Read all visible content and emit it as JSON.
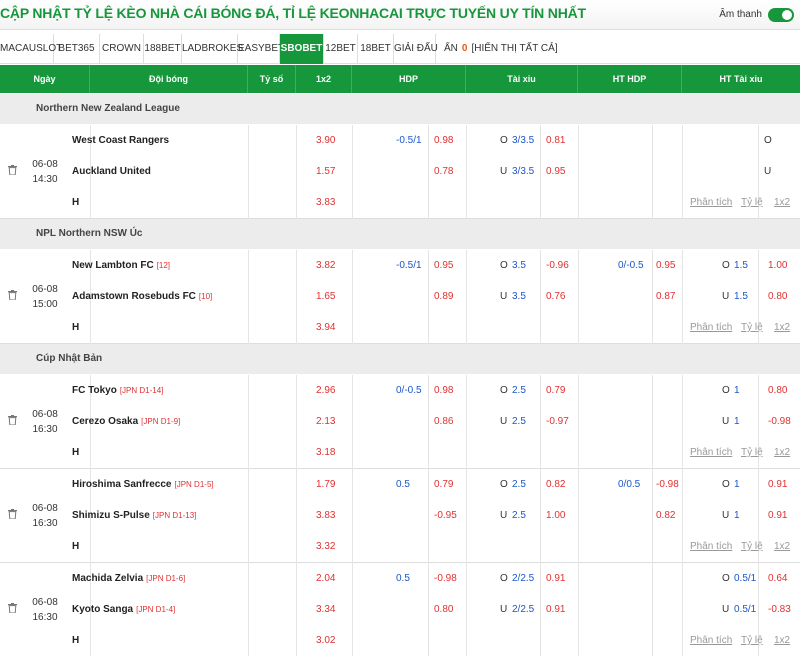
{
  "title": "CẬP NHẬT TỶ LỆ KÈO NHÀ CÁI BÓNG ĐÁ, TỈ LỆ KEONHACAI TRỰC TUYẾN UY TÍN NHẤT",
  "tabs": [
    {
      "label": "MACAUSLOT",
      "active": false
    },
    {
      "label": "BET365",
      "active": false
    },
    {
      "label": "CROWN",
      "active": false
    },
    {
      "label": "188BET",
      "active": false
    },
    {
      "label": "LADBROKES",
      "active": false
    },
    {
      "label": "EASYBET",
      "active": false
    },
    {
      "label": "SBOBET",
      "active": true
    },
    {
      "label": "12BET",
      "active": false
    },
    {
      "label": "18BET",
      "active": false
    },
    {
      "label": "GIẢI ĐẤU",
      "active": false
    }
  ],
  "hide": {
    "label_prefix": "ẨN",
    "count": "0",
    "show_all": "[HIỂN THỊ TẤT CẢ]"
  },
  "sound_label": "Âm thanh",
  "columns": {
    "date": "Ngày",
    "match": "Đội bóng",
    "score": "Tỷ số",
    "x12": "1x2",
    "hdp": "HDP",
    "ou": "Tài xỉu",
    "ht_hdp": "HT HDP",
    "ht_ou": "HT Tài xỉu"
  },
  "links": {
    "analysis": "Phân tích",
    "odds": "Tỷ lệ",
    "x12": "1x2"
  },
  "blocks": [
    {
      "type": "league",
      "name": "Northern New Zealand League"
    },
    {
      "type": "match",
      "date": "06-08",
      "time": "14:30",
      "height": 94,
      "home": {
        "name": "West Coast Rangers",
        "rank": "",
        "x12": "3.90",
        "hdp_line": "-0.5/1",
        "hdp_odd": "0.98",
        "ou_side": "O",
        "ou_line": "3/3.5",
        "ou_odd": "0.81",
        "hthdp_line": "",
        "hthdp_odd": "",
        "htou_side": "O",
        "htou_line": "",
        "htou_odd": ""
      },
      "away": {
        "name": "Auckland United",
        "rank": "",
        "x12": "1.57",
        "hdp_line": "",
        "hdp_odd": "0.78",
        "ou_side": "U",
        "ou_line": "3/3.5",
        "ou_odd": "0.95",
        "hthdp_line": "",
        "hthdp_odd": "",
        "htou_side": "U",
        "htou_line": "",
        "htou_odd": ""
      },
      "draw": {
        "label": "H",
        "x12": "3.83"
      }
    },
    {
      "type": "league",
      "name": "NPL Northern NSW Úc"
    },
    {
      "type": "match",
      "date": "06-08",
      "time": "15:00",
      "height": 94,
      "home": {
        "name": "New Lambton FC",
        "rank": "[12]",
        "x12": "3.82",
        "hdp_line": "-0.5/1",
        "hdp_odd": "0.95",
        "ou_side": "O",
        "ou_line": "3.5",
        "ou_odd": "-0.96",
        "hthdp_line": "0/-0.5",
        "hthdp_odd": "0.95",
        "htou_side": "O",
        "htou_line": "1.5",
        "htou_odd": "1.00"
      },
      "away": {
        "name": "Adamstown Rosebuds FC",
        "rank": "[10]",
        "x12": "1.65",
        "hdp_line": "",
        "hdp_odd": "0.89",
        "ou_side": "U",
        "ou_line": "3.5",
        "ou_odd": "0.76",
        "hthdp_line": "",
        "hthdp_odd": "0.87",
        "htou_side": "U",
        "htou_line": "1.5",
        "htou_odd": "0.80"
      },
      "draw": {
        "label": "H",
        "x12": "3.94"
      }
    },
    {
      "type": "league",
      "name": "Cúp Nhật Bản"
    },
    {
      "type": "match",
      "date": "06-08",
      "time": "16:30",
      "height": 94,
      "home": {
        "name": "FC Tokyo",
        "rank": "[JPN D1-14]",
        "x12": "2.96",
        "hdp_line": "0/-0.5",
        "hdp_odd": "0.98",
        "ou_side": "O",
        "ou_line": "2.5",
        "ou_odd": "0.79",
        "hthdp_line": "",
        "hthdp_odd": "",
        "htou_side": "O",
        "htou_line": "1",
        "htou_odd": "0.80"
      },
      "away": {
        "name": "Cerezo Osaka",
        "rank": "[JPN D1-9]",
        "x12": "2.13",
        "hdp_line": "",
        "hdp_odd": "0.86",
        "ou_side": "U",
        "ou_line": "2.5",
        "ou_odd": "-0.97",
        "hthdp_line": "",
        "hthdp_odd": "",
        "htou_side": "U",
        "htou_line": "1",
        "htou_odd": "-0.98"
      },
      "draw": {
        "label": "H",
        "x12": "3.18"
      }
    },
    {
      "type": "match",
      "date": "06-08",
      "time": "16:30",
      "height": 94,
      "home": {
        "name": "Hiroshima Sanfrecce",
        "rank": "[JPN D1-5]",
        "x12": "1.79",
        "hdp_line": "0.5",
        "hdp_odd": "0.79",
        "ou_side": "O",
        "ou_line": "2.5",
        "ou_odd": "0.82",
        "hthdp_line": "0/0.5",
        "hthdp_odd": "-0.98",
        "htou_side": "O",
        "htou_line": "1",
        "htou_odd": "0.91"
      },
      "away": {
        "name": "Shimizu S-Pulse",
        "rank": "[JPN D1-13]",
        "x12": "3.83",
        "hdp_line": "",
        "hdp_odd": "-0.95",
        "ou_side": "U",
        "ou_line": "2.5",
        "ou_odd": "1.00",
        "hthdp_line": "",
        "hthdp_odd": "0.82",
        "htou_side": "U",
        "htou_line": "1",
        "htou_odd": "0.91"
      },
      "draw": {
        "label": "H",
        "x12": "3.32"
      }
    },
    {
      "type": "match",
      "date": "06-08",
      "time": "16:30",
      "height": 94,
      "home": {
        "name": "Machida Zelvia",
        "rank": "[JPN D1-6]",
        "x12": "2.04",
        "hdp_line": "0.5",
        "hdp_odd": "-0.98",
        "ou_side": "O",
        "ou_line": "2/2.5",
        "ou_odd": "0.91",
        "hthdp_line": "",
        "hthdp_odd": "",
        "htou_side": "O",
        "htou_line": "0.5/1",
        "htou_odd": "0.64"
      },
      "away": {
        "name": "Kyoto Sanga",
        "rank": "[JPN D1-4]",
        "x12": "3.34",
        "hdp_line": "",
        "hdp_odd": "0.80",
        "ou_side": "U",
        "ou_line": "2/2.5",
        "ou_odd": "0.91",
        "hthdp_line": "",
        "hthdp_odd": "",
        "htou_side": "U",
        "htou_line": "0.5/1",
        "htou_odd": "-0.83"
      },
      "draw": {
        "label": "H",
        "x12": "3.02"
      }
    }
  ]
}
